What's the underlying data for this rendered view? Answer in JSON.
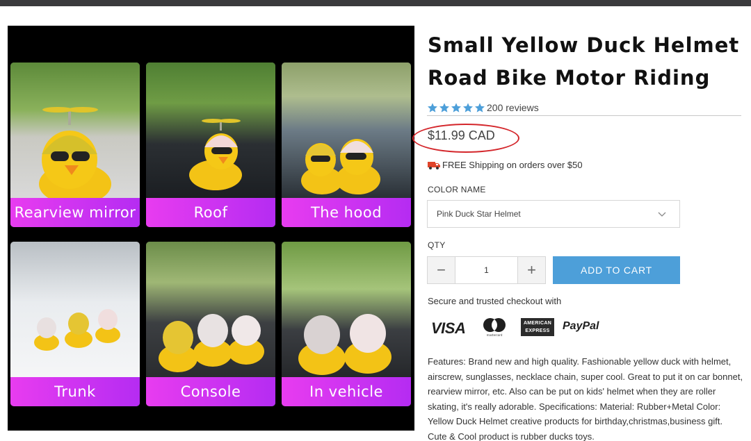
{
  "gallery": {
    "tiles": [
      {
        "caption": "Rearview mirror"
      },
      {
        "caption": "Roof"
      },
      {
        "caption": "The hood"
      },
      {
        "caption": "Trunk"
      },
      {
        "caption": "Console"
      },
      {
        "caption": "In vehicle"
      }
    ]
  },
  "product": {
    "title": "Small Yellow Duck Helmet Road Bike Motor Riding",
    "rating": 5,
    "reviews": "200 reviews",
    "price": "$11.99 CAD",
    "shipping": "FREE Shipping on orders over $50"
  },
  "options": {
    "color_label": "COLOR NAME",
    "color_value": "Pink Duck Star Helmet",
    "qty_label": "QTY",
    "qty_value": "1",
    "minus": "−",
    "plus": "+",
    "add_to_cart": "ADD TO CART"
  },
  "checkout": {
    "secure_text": "Secure and trusted checkout with",
    "visa": "VISA",
    "mastercard": "mastercard",
    "amex_line1": "AMERICAN",
    "amex_line2": "EXPRESS",
    "paypal": "PayPal"
  },
  "description": "Features: Brand new and high quality. Fashionable yellow duck with helmet, airscrew, sunglasses, necklace chain, super cool. Great to put it on car bonnet, rearview mirror, etc. Also can be put on kids' helmet when they are roller skating, it's really adorable. Specifications: Material: Rubber+Metal Color: Yellow Duck Helmet creative products for birthday,christmas,business gift. Cute & Cool product is rubber ducks toys.",
  "colors": {
    "accent_blue": "#4d9fd9",
    "star_blue": "#4d9fd9",
    "highlight_red": "#d4262b",
    "caption_pink": "#e83cf0",
    "caption_purple": "#b52cf2"
  }
}
